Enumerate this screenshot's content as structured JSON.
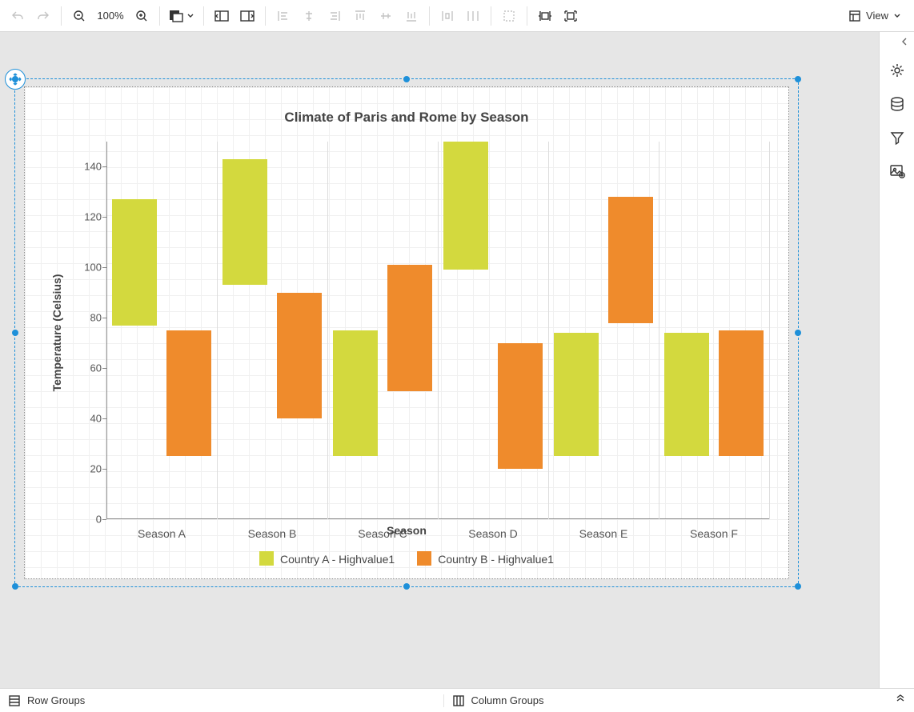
{
  "toolbar": {
    "zoom": "100%",
    "view": "View"
  },
  "side_rail": {
    "items": [
      "settings",
      "data",
      "filter",
      "image-settings"
    ]
  },
  "footer": {
    "row_groups": "Row Groups",
    "column_groups": "Column Groups"
  },
  "chart_data": {
    "type": "bar",
    "title": "Climate of Paris and Rome by Season",
    "xlabel": "Season",
    "ylabel": "Temperature (Celsius)",
    "ylim": [
      0,
      150
    ],
    "yticks": [
      0,
      20,
      40,
      60,
      80,
      100,
      120,
      140
    ],
    "categories": [
      "Season A",
      "Season B",
      "Season C",
      "Season D",
      "Season E",
      "Season F"
    ],
    "series": [
      {
        "name": "Country A - Highvalue1",
        "color": "#d3d93e",
        "low": [
          77,
          93,
          25,
          99,
          25,
          25
        ],
        "high": [
          127,
          143,
          75,
          150,
          74,
          74
        ]
      },
      {
        "name": "Country B - Highvalue1",
        "color": "#ef8b2c",
        "low": [
          25,
          40,
          51,
          20,
          78,
          25
        ],
        "high": [
          75,
          90,
          101,
          70,
          128,
          75
        ]
      }
    ]
  },
  "colors": {
    "seriesA": "#d3d93e",
    "seriesB": "#ef8b2c",
    "selection": "#1e90d9"
  }
}
